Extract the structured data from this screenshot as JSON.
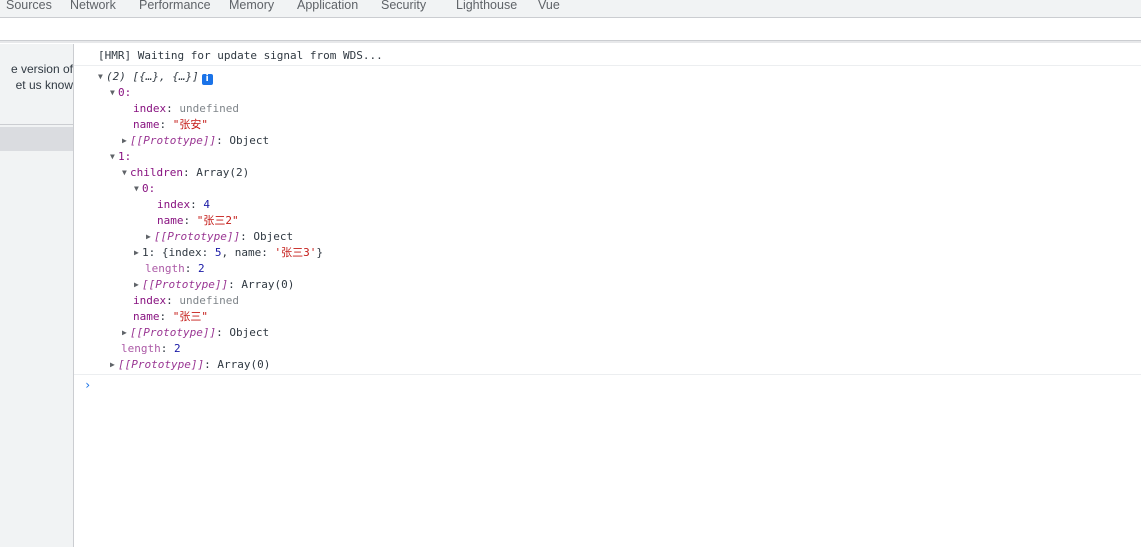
{
  "tabs": [
    {
      "label": "Sources"
    },
    {
      "label": "Network"
    },
    {
      "label": "Performance"
    },
    {
      "label": "Memory"
    },
    {
      "label": "Application"
    },
    {
      "label": "Security"
    },
    {
      "label": "Lighthouse"
    },
    {
      "label": "Vue"
    }
  ],
  "sidebar": {
    "message_line1": "e version of",
    "message_line2": "et us know"
  },
  "console": {
    "hmr_message": "[HMR] Waiting for update signal from WDS...",
    "prompt_symbol": "›",
    "tree": {
      "root_summary": "(2) [{…}, {…}]",
      "item0_key": "0:",
      "item0_index_key": "index",
      "item0_index_val": "undefined",
      "item0_name_key": "name",
      "item0_name_val": "\"张安\"",
      "proto_key": "[[Prototype]]",
      "object_label": "Object",
      "item1_key": "1:",
      "children_key": "children",
      "children_val": "Array(2)",
      "child0_key": "0:",
      "child0_index_key": "index",
      "child0_index_val": "4",
      "child0_name_key": "name",
      "child0_name_val": "\"张三2\"",
      "child1_preview_prefix": "1: {index: ",
      "child1_index_val": "5",
      "child1_mid": ", name: ",
      "child1_name_val": "'张三3'",
      "child1_suffix": "}",
      "length_key": "length",
      "children_length_val": "2",
      "array0_label": "Array(0)",
      "item1_index_key": "index",
      "item1_index_val": "undefined",
      "item1_name_key": "name",
      "item1_name_val": "\"张三\"",
      "root_length_val": "2"
    }
  }
}
